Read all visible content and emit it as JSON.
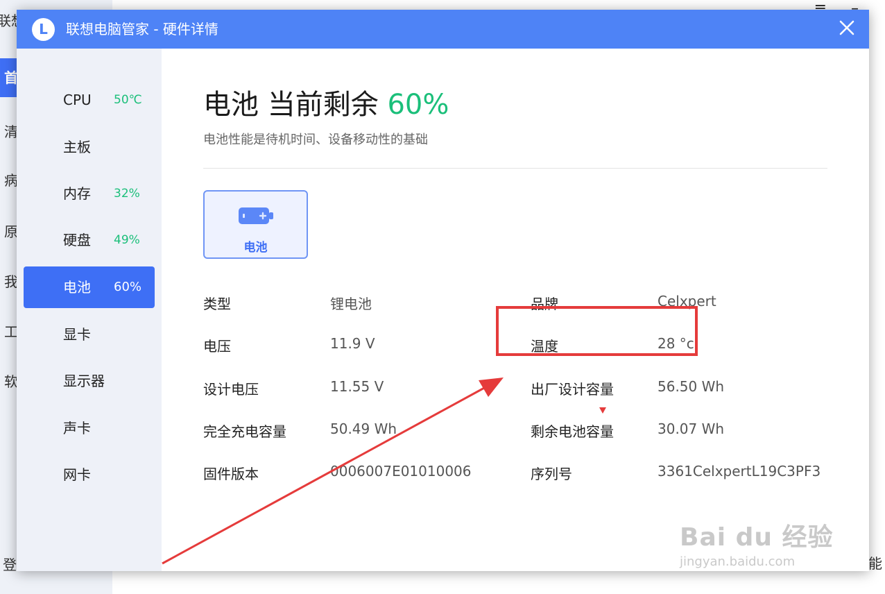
{
  "background_app": {
    "sidebar_items": [
      "联想",
      "首",
      "清",
      "病",
      "原",
      "我",
      "工",
      "软"
    ],
    "login_text": "登",
    "bottom_right_text": "功能"
  },
  "window": {
    "title": "联想电脑管家 - 硬件详情",
    "logo_letter": "L",
    "close_icon": "close-icon"
  },
  "sidebar": {
    "items": [
      {
        "label": "CPU",
        "value": "50℃"
      },
      {
        "label": "主板",
        "value": ""
      },
      {
        "label": "内存",
        "value": "32%"
      },
      {
        "label": "硬盘",
        "value": "49%"
      },
      {
        "label": "电池",
        "value": "60%",
        "active": true
      },
      {
        "label": "显卡",
        "value": ""
      },
      {
        "label": "显示器",
        "value": ""
      },
      {
        "label": "声卡",
        "value": ""
      },
      {
        "label": "网卡",
        "value": ""
      }
    ]
  },
  "main": {
    "heading_prefix": "电池 当前剩余",
    "heading_percent": "60%",
    "subtitle": "电池性能是待机时间、设备移动性的基础",
    "battery_card": {
      "label": "电池",
      "icon": "battery-icon"
    },
    "details": {
      "left": [
        {
          "key": "类型",
          "value": "锂电池"
        },
        {
          "key": "电压",
          "value": "11.9 V"
        },
        {
          "key": "设计电压",
          "value": "11.55 V"
        },
        {
          "key": "完全充电容量",
          "value": "50.49 Wh"
        },
        {
          "key": "固件版本",
          "value": "0006007E01010006"
        }
      ],
      "right": [
        {
          "key": "品牌",
          "value": "Celxpert"
        },
        {
          "key": "温度",
          "value": "28 °c"
        },
        {
          "key": "出厂设计容量",
          "value": "56.50 Wh"
        },
        {
          "key": "剩余电池容量",
          "value": "30.07 Wh"
        },
        {
          "key": "序列号",
          "value": "3361CelxpertL19C3PF3"
        }
      ]
    }
  },
  "annotation": {
    "color": "#e53b3b"
  },
  "watermark": {
    "main": "Bai du 经验",
    "url": "jingyan.baidu.com"
  },
  "colors": {
    "accent": "#4e83f6",
    "active_nav": "#3e6ff5",
    "green": "#1bbf7a"
  }
}
